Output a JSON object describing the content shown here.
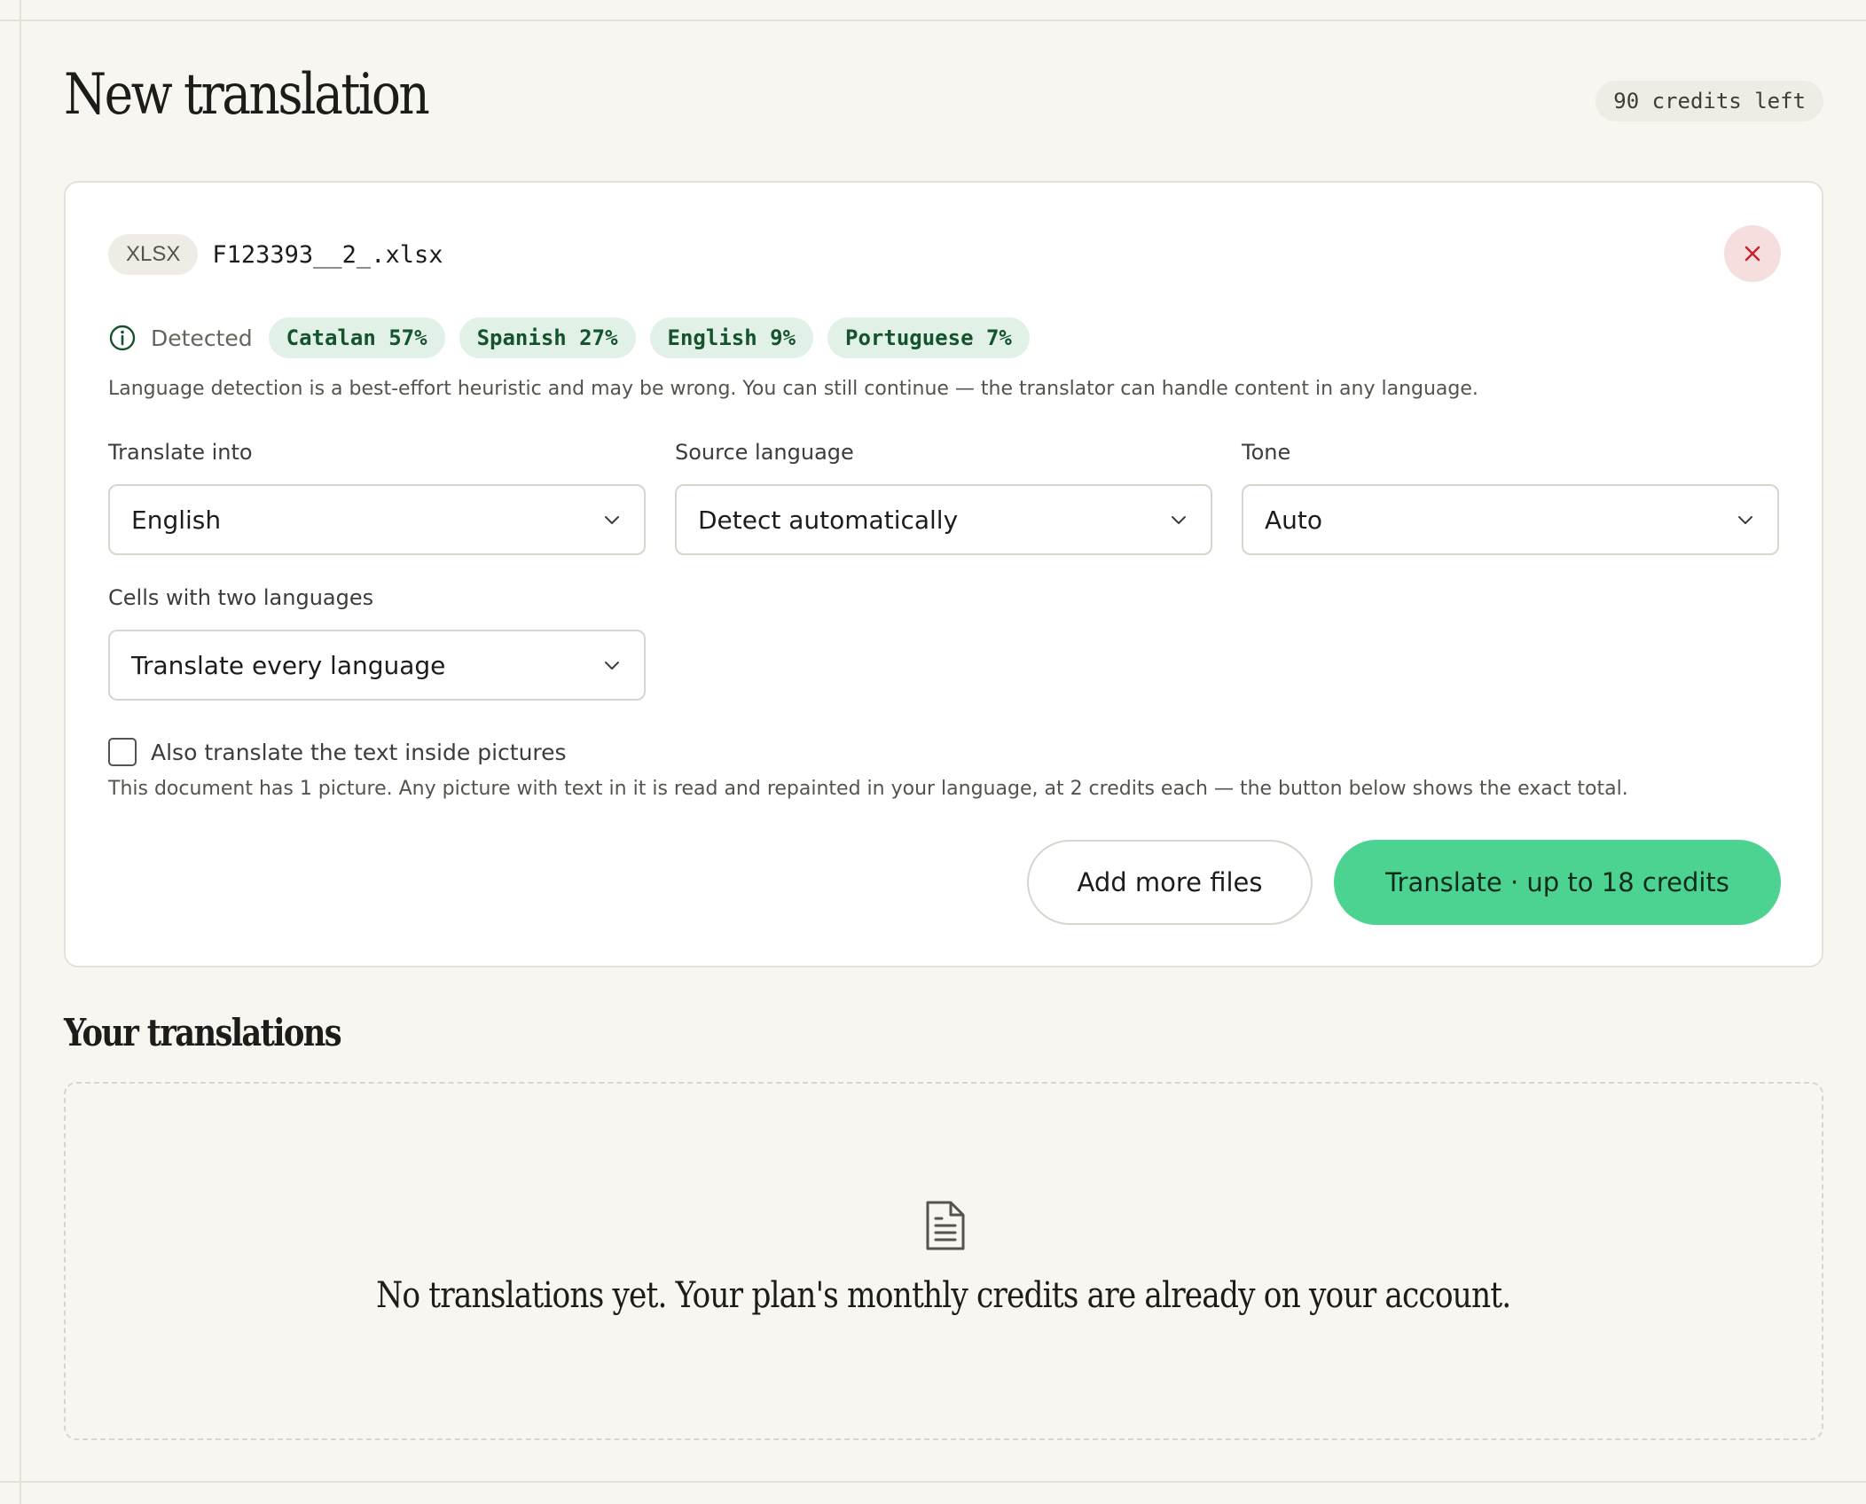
{
  "header": {
    "title": "New translation",
    "credits_left": "90 credits left"
  },
  "file": {
    "type": "XLSX",
    "name": "F123393__2_.xlsx"
  },
  "detection": {
    "label": "Detected",
    "languages": [
      {
        "label": "Catalan 57%",
        "language": "Catalan",
        "percent": 57
      },
      {
        "label": "Spanish 27%",
        "language": "Spanish",
        "percent": 27
      },
      {
        "label": "English 9%",
        "language": "English",
        "percent": 9
      },
      {
        "label": "Portuguese 7%",
        "language": "Portuguese",
        "percent": 7
      }
    ],
    "note": "Language detection is a best-effort heuristic and may be wrong. You can still continue — the translator can handle content in any language."
  },
  "fields": {
    "translate_into": {
      "label": "Translate into",
      "value": "English"
    },
    "source_language": {
      "label": "Source language",
      "value": "Detect automatically"
    },
    "tone": {
      "label": "Tone",
      "value": "Auto"
    },
    "two_languages": {
      "label": "Cells with two languages",
      "value": "Translate every language"
    }
  },
  "pictures": {
    "checkbox_label": "Also translate the text inside pictures",
    "checked": false,
    "note": "This document has 1 picture. Any picture with text in it is read and repainted in your language, at 2 credits each — the button below shows the exact total."
  },
  "actions": {
    "add_more": "Add more files",
    "translate": "Translate · up to 18 credits"
  },
  "history": {
    "title": "Your translations",
    "empty_message": "No translations yet. Your plan's monthly credits are already on your account."
  },
  "colors": {
    "background": "#f8f6f1",
    "accent": "#4cd392",
    "chip_bg": "#e2f1e8",
    "chip_text": "#14532d",
    "close_bg": "#f7dede",
    "close_icon": "#c0262d"
  },
  "icons": [
    "close-icon",
    "info-icon",
    "chevron-down-icon",
    "document-icon"
  ]
}
